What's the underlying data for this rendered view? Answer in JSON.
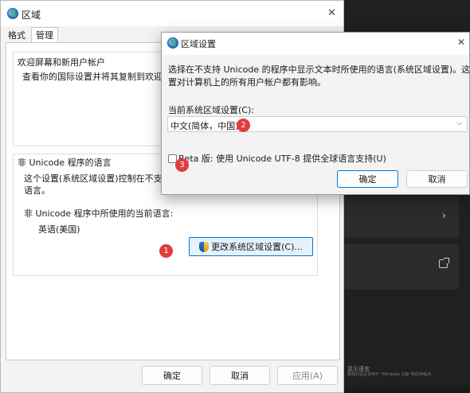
{
  "main_window": {
    "title": "区域",
    "close_glyph": "✕",
    "tabs": [
      {
        "label": "格式",
        "active": false
      },
      {
        "label": "管理",
        "active": true
      }
    ],
    "welcome_group": {
      "title": "欢迎屏幕和新用户帐户",
      "description": "查看你的国际设置并将其复制到欢迎屏"
    },
    "unicode_group": {
      "title": "非 Unicode 程序的语言",
      "description_line1": "这个设置(系统区域设置)控制在不支持",
      "description_line2": "语言。",
      "current_language_label": "非 Unicode 程序中所使用的当前语言:",
      "current_language_value": "英语(美国)",
      "change_button_label": "更改系统区域设置(C)..."
    },
    "footer": {
      "ok_label": "确定",
      "cancel_label": "取消",
      "apply_label": "应用(A)"
    }
  },
  "dialog": {
    "title": "区域设置",
    "close_glyph": "✕",
    "description_line1": "选择在不支持 Unicode 的程序中显示文本时所使用的语言(系统区域设置)。这个设",
    "description_line2": "置对计算机上的所有用户帐户都有影响。",
    "locale_label": "当前系统区域设置(C):",
    "locale_value": "中文(简体，中国)",
    "beta_checkbox_label": "Beta 版: 使用 Unicode UTF-8 提供全球语言支持(U)",
    "beta_checked": false,
    "ok_label": "确定",
    "cancel_label": "取消"
  },
  "background_app": {
    "chevron_glyph": "›",
    "strip_text": "显示语言",
    "strip_subtext": "推荐的语言将用于 \"Windows 功能\"和应用程序."
  },
  "markers": [
    "1",
    "2",
    "3"
  ],
  "colors": {
    "accent": "#0078d4",
    "marker": "#e23c3c",
    "dark_bg": "#202020"
  }
}
